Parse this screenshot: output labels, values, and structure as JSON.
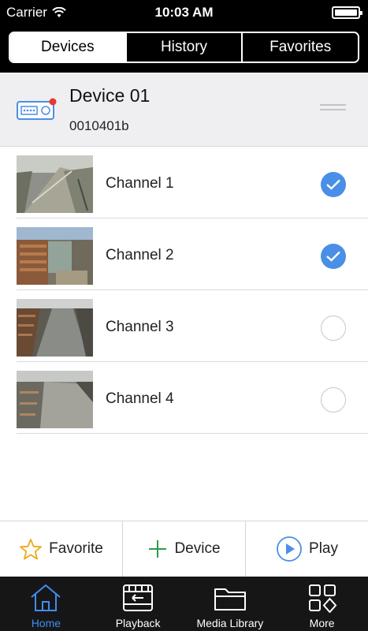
{
  "status_bar": {
    "carrier": "Carrier",
    "time": "10:03 AM"
  },
  "segments": [
    {
      "label": "Devices",
      "active": true
    },
    {
      "label": "History",
      "active": false
    },
    {
      "label": "Favorites",
      "active": false
    }
  ],
  "device": {
    "name": "Device 01",
    "id": "0010401b",
    "online_dot_color": "#e53935"
  },
  "channels": [
    {
      "label": "Channel 1",
      "checked": true
    },
    {
      "label": "Channel 2",
      "checked": true
    },
    {
      "label": "Channel 3",
      "checked": false
    },
    {
      "label": "Channel 4",
      "checked": false
    }
  ],
  "actions": {
    "favorite_label": "Favorite",
    "device_label": "Device",
    "play_label": "Play"
  },
  "tabs": [
    {
      "label": "Home",
      "icon": "home-icon",
      "active": true
    },
    {
      "label": "Playback",
      "icon": "playback-icon",
      "active": false
    },
    {
      "label": "Media Library",
      "icon": "folder-icon",
      "active": false
    },
    {
      "label": "More",
      "icon": "more-grid-icon",
      "active": false
    }
  ],
  "colors": {
    "accent": "#4a8fe7",
    "tab_active": "#3f8ef0",
    "star": "#f0a81a",
    "plus": "#2e9b4e"
  }
}
